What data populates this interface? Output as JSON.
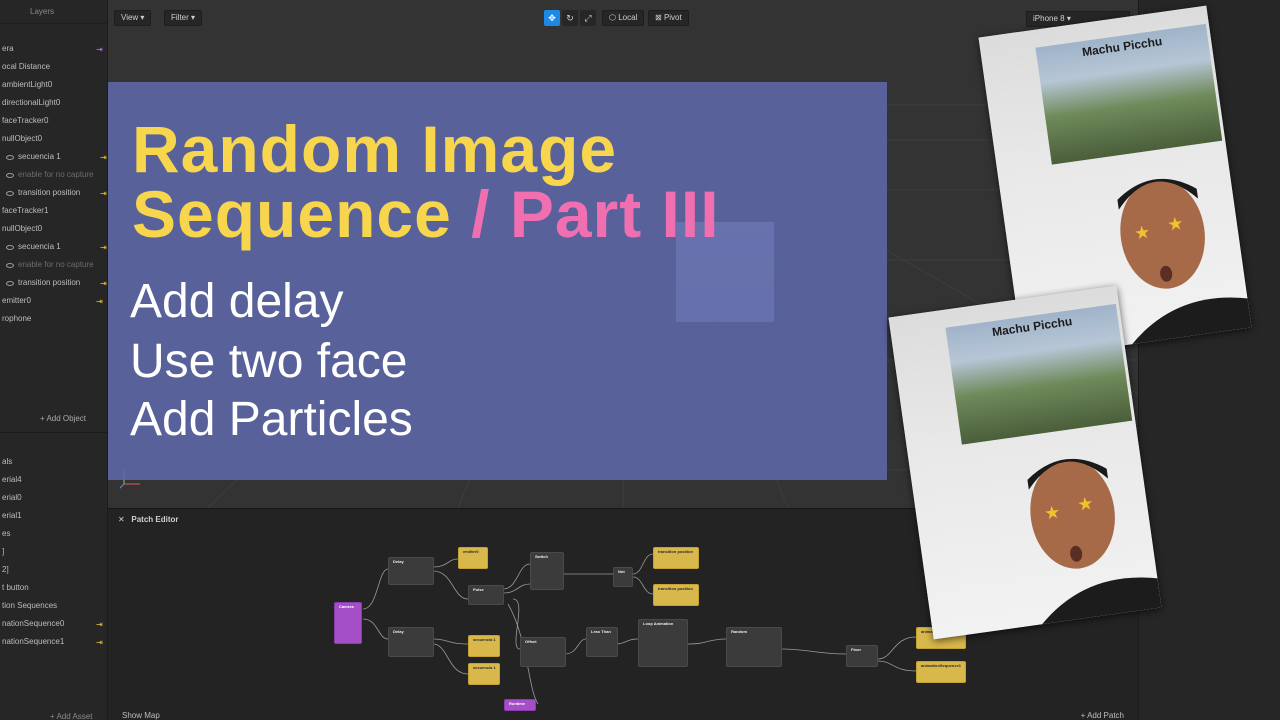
{
  "layers_panel": {
    "title": "Layers",
    "items": [
      {
        "label": "era",
        "indent": 0,
        "dim": false,
        "action": "purple"
      },
      {
        "label": "ocal Distance",
        "indent": 0,
        "dim": false,
        "action": ""
      },
      {
        "label": "ambientLight0",
        "indent": 0,
        "dim": false,
        "action": ""
      },
      {
        "label": "directionalLight0",
        "indent": 0,
        "dim": false,
        "action": ""
      },
      {
        "label": "faceTracker0",
        "indent": 0,
        "dim": false,
        "action": ""
      },
      {
        "label": "nullObject0",
        "indent": 0,
        "dim": false,
        "action": ""
      },
      {
        "label": "secuencia 1",
        "indent": 1,
        "dim": false,
        "action": "yellow"
      },
      {
        "label": "enable for no capture",
        "indent": 1,
        "dim": true,
        "action": ""
      },
      {
        "label": "transition position",
        "indent": 1,
        "dim": false,
        "action": "yellow"
      },
      {
        "label": "faceTracker1",
        "indent": 0,
        "dim": false,
        "action": ""
      },
      {
        "label": "nullObject0",
        "indent": 0,
        "dim": false,
        "action": ""
      },
      {
        "label": "secuencia 1",
        "indent": 1,
        "dim": false,
        "action": "yellow"
      },
      {
        "label": "enable for no capture",
        "indent": 1,
        "dim": true,
        "action": ""
      },
      {
        "label": "transition position",
        "indent": 1,
        "dim": false,
        "action": "yellow"
      },
      {
        "label": "emitter0",
        "indent": 0,
        "dim": false,
        "action": "yellow"
      },
      {
        "label": "rophone",
        "indent": 0,
        "dim": false,
        "action": ""
      }
    ],
    "add_object": "+ Add Object",
    "assets": [
      {
        "label": "als",
        "action": ""
      },
      {
        "label": "erial4",
        "action": ""
      },
      {
        "label": "erial0",
        "action": ""
      },
      {
        "label": "erial1",
        "action": ""
      },
      {
        "label": "es",
        "action": ""
      },
      {
        "label": "]",
        "action": ""
      },
      {
        "label": "2]",
        "action": ""
      },
      {
        "label": "t button",
        "action": ""
      },
      {
        "label": "tion Sequences",
        "action": ""
      },
      {
        "label": "nationSequence0",
        "action": "yellow"
      },
      {
        "label": "nationSequence1",
        "action": "yellow"
      }
    ],
    "add_asset": "+ Add Asset"
  },
  "viewport": {
    "view_label": "View",
    "filter_label": "Filter",
    "local_label": "Local",
    "pivot_label": "Pivot",
    "device_label": "iPhone 8"
  },
  "banner": {
    "title_line1": "Random Image",
    "title_line2": "Sequence",
    "title_accent": "/ Part III",
    "items": [
      "Add delay",
      "Use two face",
      "Add Particles"
    ]
  },
  "patch_editor": {
    "title": "Patch Editor",
    "show_map": "Show Map",
    "add_patch": "+ Add Patch",
    "nodes": [
      {
        "name": "Camera",
        "kind": "purple"
      },
      {
        "name": "Delay",
        "kind": "grey"
      },
      {
        "name": "emitter0",
        "kind": "yellow"
      },
      {
        "name": "Pulse",
        "kind": "grey"
      },
      {
        "name": "Switch",
        "kind": "grey"
      },
      {
        "name": "Not",
        "kind": "grey"
      },
      {
        "name": "transition position",
        "kind": "yellow"
      },
      {
        "name": "transition position",
        "kind": "yellow"
      },
      {
        "name": "Delay",
        "kind": "grey"
      },
      {
        "name": "secuencia 1",
        "kind": "yellow"
      },
      {
        "name": "secuencia 1",
        "kind": "yellow"
      },
      {
        "name": "Offset",
        "kind": "grey"
      },
      {
        "name": "Less Than",
        "kind": "grey"
      },
      {
        "name": "Loop Animation",
        "kind": "grey"
      },
      {
        "name": "Random",
        "kind": "grey"
      },
      {
        "name": "Floor",
        "kind": "grey"
      },
      {
        "name": "animationSequence0",
        "kind": "yellow"
      },
      {
        "name": "animationSequence1",
        "kind": "yellow"
      },
      {
        "name": "Runtime",
        "kind": "purple"
      }
    ]
  },
  "photos": {
    "label": "Machu Picchu"
  },
  "colors": {
    "title_yellow": "#f7d54c",
    "accent_pink": "#f06fb0",
    "banner": "#5d68a8",
    "active_tool": "#1e88e5"
  }
}
